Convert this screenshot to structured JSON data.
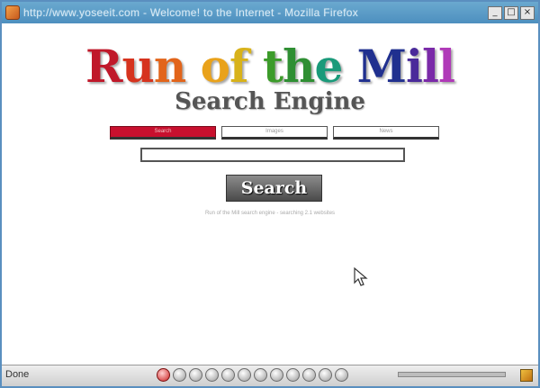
{
  "window": {
    "title": "http://www.yoseeit.com - Welcome! to the Internet - Mozilla Firefox",
    "controls": {
      "minimize": "_",
      "maximize": "□",
      "close": "×"
    }
  },
  "logo": {
    "letters": [
      {
        "ch": "R",
        "color": "#c0182a"
      },
      {
        "ch": "u",
        "color": "#d6331e"
      },
      {
        "ch": "n",
        "color": "#e2641a"
      },
      {
        "ch": " ",
        "color": "#000000"
      },
      {
        "ch": "o",
        "color": "#e9a21b"
      },
      {
        "ch": "f",
        "color": "#d8b21a"
      },
      {
        "ch": " ",
        "color": "#000000"
      },
      {
        "ch": "t",
        "color": "#3c9b2a"
      },
      {
        "ch": "h",
        "color": "#2f8f33"
      },
      {
        "ch": "e",
        "color": "#1a9a7a"
      },
      {
        "ch": " ",
        "color": "#000000"
      },
      {
        "ch": "M",
        "color": "#20308f"
      },
      {
        "ch": "i",
        "color": "#4a2a9a"
      },
      {
        "ch": "l",
        "color": "#7a2aa8"
      },
      {
        "ch": "l",
        "color": "#b03ab8"
      }
    ],
    "subtitle": "Search Engine"
  },
  "tabs": [
    {
      "label": "Search",
      "active": true
    },
    {
      "label": "Images",
      "active": false
    },
    {
      "label": "News",
      "active": false
    }
  ],
  "search": {
    "value": "",
    "button_label": "Search"
  },
  "footnote": "Run of the Mill search engine - searching 2.1 websites",
  "statusbar": {
    "text": "Done",
    "icons": [
      "stop-icon",
      "back-icon",
      "forward-icon",
      "reload-icon",
      "home-icon",
      "bookmark-icon",
      "history-icon",
      "mail-icon",
      "print-icon",
      "zoom-icon",
      "settings-icon",
      "info-icon"
    ]
  },
  "colors": {
    "accent": "#c8102e",
    "titlebar": "#5a9bc8"
  }
}
